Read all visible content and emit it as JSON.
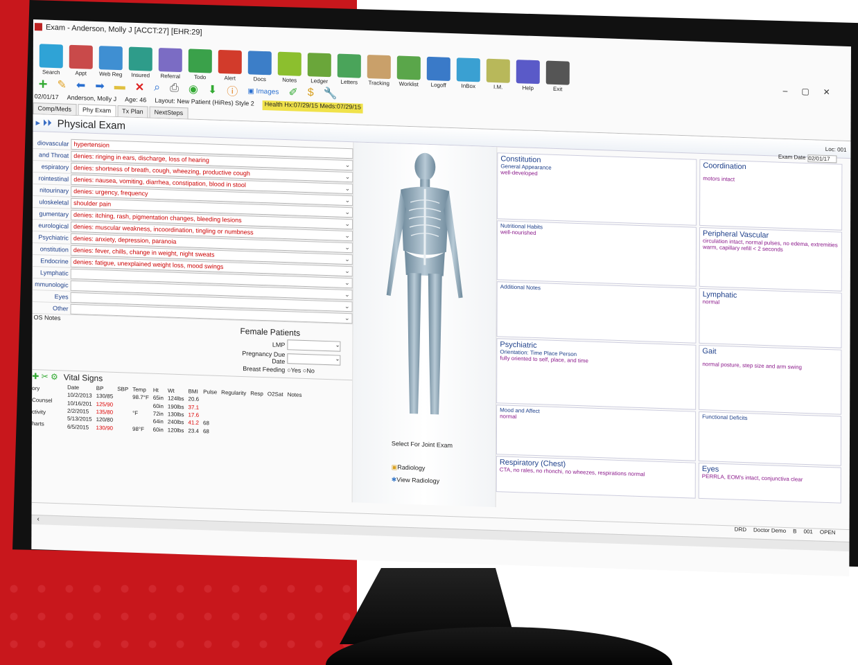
{
  "window": {
    "title": "Exam - Anderson, Molly J [ACCT:27] [EHR:29]"
  },
  "toolbar": [
    {
      "label": "Search",
      "icon": "search-icon",
      "color": "#2fa3d6"
    },
    {
      "label": "Appt",
      "icon": "calendar-icon",
      "color": "#c94a4a"
    },
    {
      "label": "Web Reg",
      "icon": "cloud-icon",
      "color": "#3f8fd2"
    },
    {
      "label": "Insured",
      "icon": "card-icon",
      "color": "#2e9c8a"
    },
    {
      "label": "Referral",
      "icon": "people-icon",
      "color": "#7b6cc4"
    },
    {
      "label": "Todo",
      "icon": "pin-icon",
      "color": "#3aa14a"
    },
    {
      "label": "Alert",
      "icon": "alert-icon",
      "color": "#d23b2b"
    },
    {
      "label": "Docs",
      "icon": "image-icon",
      "color": "#3c7ec8"
    },
    {
      "label": "Notes",
      "icon": "notes-icon",
      "color": "#8cbf2e"
    },
    {
      "label": "Ledger",
      "icon": "dollar-icon",
      "color": "#6aa63a"
    },
    {
      "label": "Letters",
      "icon": "letter-icon",
      "color": "#4aa45a"
    },
    {
      "label": "Tracking",
      "icon": "footprint-icon",
      "color": "#c9a06a"
    },
    {
      "label": "Worklist",
      "icon": "clipboard-icon",
      "color": "#5aa64a"
    },
    {
      "label": "Logoff",
      "icon": "moon-icon",
      "color": "#3a7ac8"
    },
    {
      "label": "InBox",
      "icon": "inbox-icon",
      "color": "#3aa0d2"
    },
    {
      "label": "I.M.",
      "icon": "chat-icon",
      "color": "#b8b85a"
    },
    {
      "label": "Help",
      "icon": "help-icon",
      "color": "#5a5ac8"
    },
    {
      "label": "Exit",
      "icon": "exit-icon",
      "color": "#555555"
    }
  ],
  "patient": {
    "date": "02/01/17",
    "name": "Anderson, Molly J",
    "age": "Age: 46",
    "layout": "Layout: New Patient (HiRes) Style 2",
    "health": "Health Hx:07/29/15  Meds:07/29/15"
  },
  "tabs": [
    "Comp/Meds",
    "Phy Exam",
    "Tx Plan",
    "NextSteps"
  ],
  "section": {
    "title": "Physical Exam",
    "loc": "Loc: 001"
  },
  "systems": [
    {
      "label": "diovascular",
      "value": "hypertension"
    },
    {
      "label": "and Throat",
      "value": "denies: ringing in ears, discharge, loss of hearing"
    },
    {
      "label": "espiratory",
      "value": "denies: shortness of breath, cough, wheezing, productive cough"
    },
    {
      "label": "rointestinal",
      "value": "denies: nausea, vomiting, diarrhea, constipation, blood in stool"
    },
    {
      "label": "nitourinary",
      "value": "denies: urgency, frequency"
    },
    {
      "label": "uloskeletal",
      "value": "shoulder pain"
    },
    {
      "label": "gumentary",
      "value": "denies: itching, rash, pigmentation changes, bleeding lesions"
    },
    {
      "label": "eurological",
      "value": "denies: muscular weakness, incoordination, tingling or numbness"
    },
    {
      "label": "Psychiatric",
      "value": "denies: anxiety, depression, paranoia"
    },
    {
      "label": "onstitution",
      "value": "denies: fever, chills, change in weight, night sweats"
    },
    {
      "label": "Endocrine",
      "value": "denies: fatigue, unexplained weight loss, mood swings"
    },
    {
      "label": "Lymphatic",
      "value": ""
    },
    {
      "label": "mmunologic",
      "value": ""
    },
    {
      "label": "Eyes",
      "value": ""
    },
    {
      "label": "Other",
      "value": ""
    }
  ],
  "os_notes_label": "OS Notes",
  "female": {
    "title": "Female Patients",
    "lmp": "LMP",
    "pregnancy": "Pregnancy Due Date",
    "breastfeeding": "Breast Feeding",
    "yes": "Yes",
    "no": "No"
  },
  "vitals": {
    "title": "Vital Signs",
    "nav": [
      "ory",
      "Counsel",
      "ctivity",
      "harts"
    ],
    "columns": [
      "Date",
      "BP",
      "SBP",
      "Temp",
      "Ht",
      "Wt",
      "BMI",
      "Pulse",
      "Regularity",
      "Resp",
      "O2Sat",
      "Notes"
    ],
    "rows": [
      {
        "date": "10/2/2013",
        "bp": "130/85",
        "temp": "98.7°F",
        "ht": "65in",
        "wt": "124lbs",
        "bmi": "20.6",
        "pulse": "",
        "bp_red": false,
        "bmi_red": false
      },
      {
        "date": "10/16/201",
        "bp": "125/90",
        "temp": "",
        "ht": "60in",
        "wt": "190lbs",
        "bmi": "37.1",
        "pulse": "",
        "bp_red": true,
        "bmi_red": true
      },
      {
        "date": "2/2/2015",
        "bp": "135/80",
        "temp": "°F",
        "ht": "72in",
        "wt": "130lbs",
        "bmi": "17.6",
        "pulse": "",
        "bp_red": true,
        "bmi_red": true
      },
      {
        "date": "5/13/2015",
        "bp": "120/80",
        "temp": "",
        "ht": "64in",
        "wt": "240lbs",
        "bmi": "41.2",
        "pulse": "68",
        "bp_red": false,
        "bmi_red": true
      },
      {
        "date": "6/5/2015",
        "bp": "130/90",
        "temp": "98°F",
        "ht": "60in",
        "wt": "120lbs",
        "bmi": "23.4",
        "pulse": "68",
        "bp_red": true,
        "bmi_red": false
      }
    ]
  },
  "center": {
    "joint_exam": "Select For Joint Exam",
    "radiology": "Radiology",
    "view_radiology": "View Radiology"
  },
  "exam_date": {
    "label": "Exam Date",
    "value": "02/01/17"
  },
  "boxes": {
    "constitution": {
      "title": "Constitution",
      "sub": "General Appearance",
      "value": "well-developed"
    },
    "coordination": {
      "title": "Coordination",
      "value": "motors intact"
    },
    "nutritional": {
      "title": "Nutritional Habits",
      "value": "well-nourished"
    },
    "peripheral": {
      "title": "Peripheral Vascular",
      "value": "circulation intact, normal pulses, no edema, extremities warm, capillary refill < 2 seconds"
    },
    "additional": {
      "title": "Additional Notes",
      "value": ""
    },
    "lymphatic": {
      "title": "Lymphatic",
      "value": "normal"
    },
    "psychiatric": {
      "title": "Psychiatric",
      "sub": "Orientation:  Time Place Person",
      "value": "fully oriented to self, place, and time"
    },
    "gait": {
      "title": "Gait",
      "value": "normal posture, step size and arm swing"
    },
    "mood": {
      "title": "Mood and Affect",
      "value": "normal"
    },
    "functional": {
      "title": "Functional Deficits",
      "value": ""
    },
    "respiratory": {
      "title": "Respiratory (Chest)",
      "value": "CTA, no rales, no rhonchi, no wheezes, respirations normal"
    },
    "eyes": {
      "title": "Eyes",
      "value": "PERRLA, EOM's intact, conjunctiva clear"
    }
  },
  "status": {
    "user_code": "DRD",
    "user": "Doctor Demo",
    "b": "B",
    "office": "001",
    "state": "OPEN"
  }
}
